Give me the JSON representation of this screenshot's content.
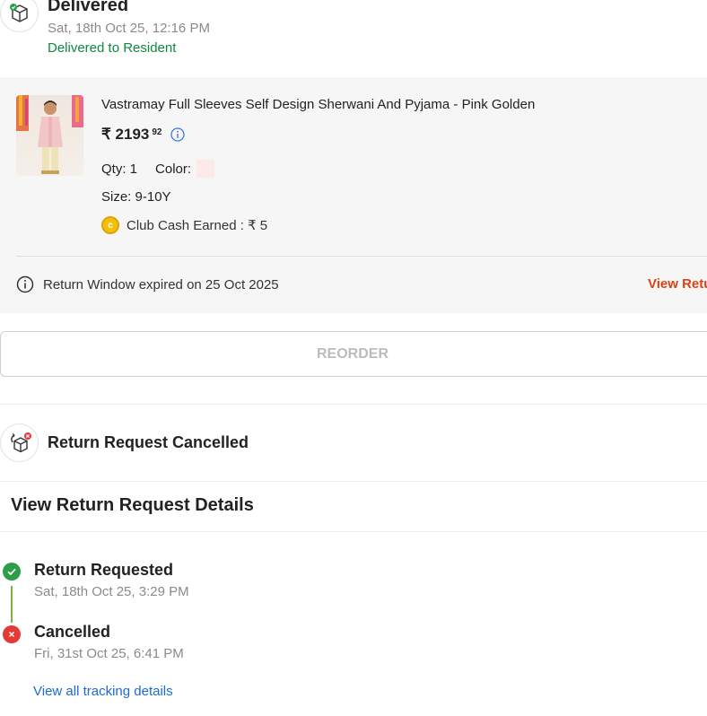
{
  "delivery": {
    "icon": "package-check-icon",
    "title": "Delivered",
    "date": "Sat, 18th Oct 25, 12:16 PM",
    "note": "Delivered to Resident"
  },
  "item": {
    "name": "Vastramay Full Sleeves Self Design Sherwani And Pyjama - Pink Golden",
    "price_main": "₹ 2193",
    "price_fraction": "92",
    "qty": "Qty: 1",
    "color_label": "Color:",
    "color_value": "#fde8ea",
    "size": "Size: 9-10Y",
    "club_cash": "Club Cash Earned : ₹ 5",
    "return_window": "Return Window expired on 25 Oct 2025",
    "view_return_link": "View Retu"
  },
  "actions": {
    "reorder_label": "REORDER"
  },
  "return_request": {
    "icon": "package-return-cancel-icon",
    "title": "Return Request Cancelled",
    "details_link": "View Return Request Details"
  },
  "timeline": [
    {
      "title": "Return Requested",
      "date": "Sat, 18th Oct 25, 3:29 PM",
      "status": "done",
      "color": "#2e9d47"
    },
    {
      "title": "Cancelled",
      "date": "Fri, 31st Oct 25, 6:41 PM",
      "status": "cancelled",
      "color": "#e53935"
    }
  ],
  "tracking_link": "View all tracking details"
}
